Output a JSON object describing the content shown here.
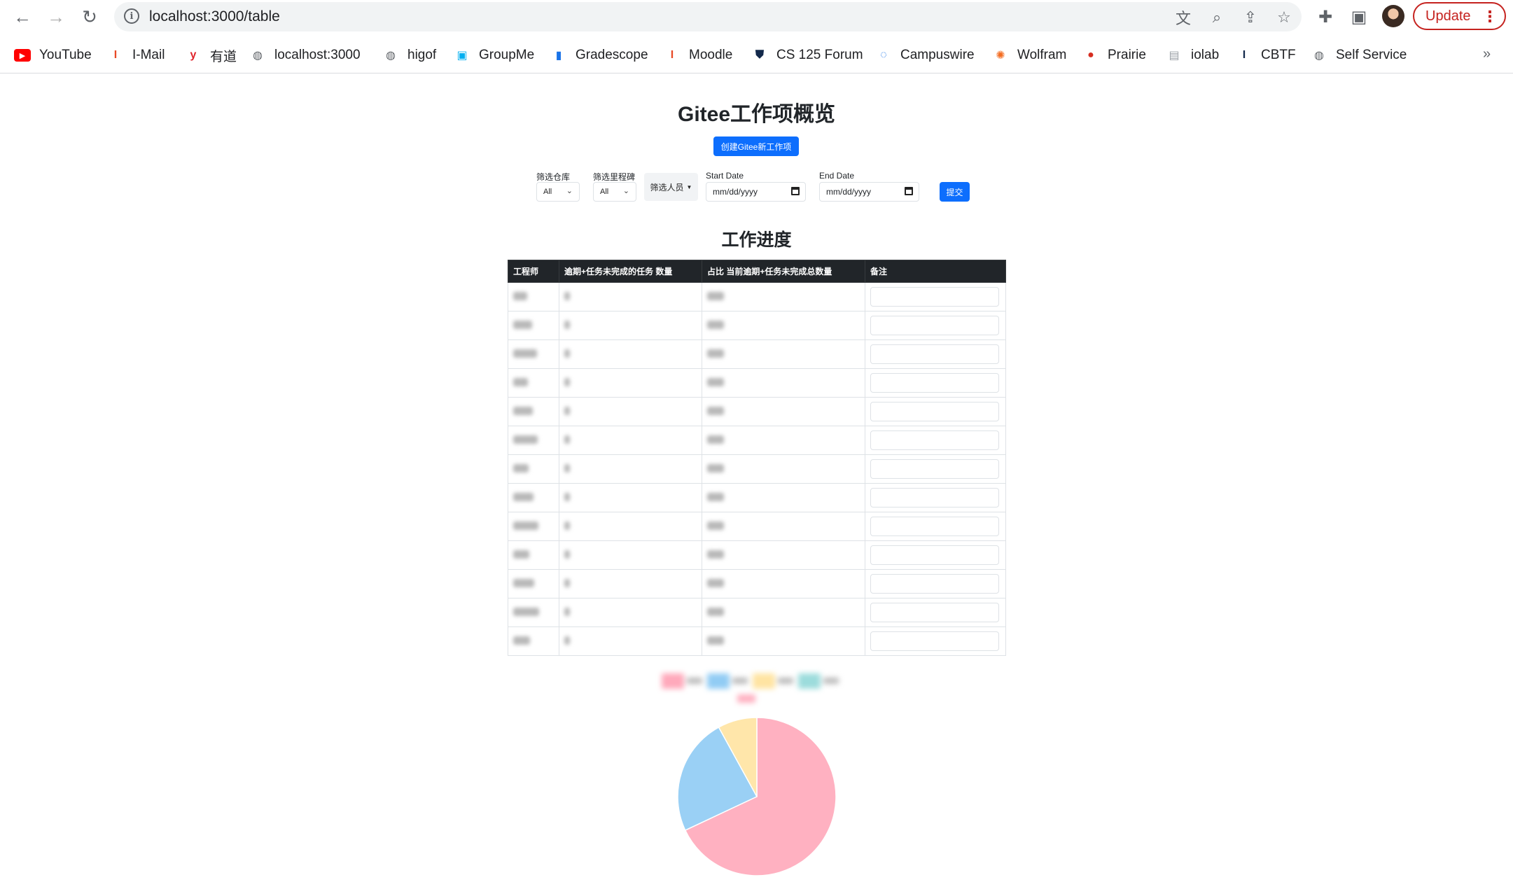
{
  "browser": {
    "url": "localhost:3000/table",
    "update_label": "Update",
    "bookmarks": [
      {
        "label": "YouTube",
        "icon": "youtube-icon",
        "color": "#ff0000"
      },
      {
        "label": "I-Mail",
        "icon": "illinois-icon",
        "color": "#e84a27"
      },
      {
        "label": "有道",
        "icon": "youdao-icon",
        "color": "#e0242b"
      },
      {
        "label": "localhost:3000",
        "icon": "globe-icon",
        "color": "#5f6368"
      },
      {
        "label": "higof",
        "icon": "globe-icon",
        "color": "#5f6368"
      },
      {
        "label": "GroupMe",
        "icon": "groupme-icon",
        "color": "#00aff0"
      },
      {
        "label": "Gradescope",
        "icon": "gradescope-icon",
        "color": "#1a73e8"
      },
      {
        "label": "Moodle",
        "icon": "illinois-icon",
        "color": "#e84a27"
      },
      {
        "label": "CS 125 Forum",
        "icon": "shield-icon",
        "color": "#13294b"
      },
      {
        "label": "Campuswire",
        "icon": "campuswire-icon",
        "color": "#1a73e8"
      },
      {
        "label": "Wolfram",
        "icon": "wolfram-icon",
        "color": "#f36c21"
      },
      {
        "label": "Prairie",
        "icon": "prairie-icon",
        "color": "#d62d20"
      },
      {
        "label": "iolab",
        "icon": "document-icon",
        "color": "#9aa0a6"
      },
      {
        "label": "CBTF",
        "icon": "illinois-icon",
        "color": "#13294b"
      },
      {
        "label": "Self Service",
        "icon": "globe-icon",
        "color": "#5f6368"
      }
    ]
  },
  "page": {
    "title": "Gitee工作项概览",
    "create_button": "创建Gitee新工作项",
    "filters": {
      "repo_label": "筛选仓库",
      "repo_value": "All",
      "milestone_label": "筛选里程碑",
      "milestone_value": "All",
      "person_label": "筛选人员",
      "start_label": "Start Date",
      "start_placeholder": "mm/dd/yyyy",
      "end_label": "End Date",
      "end_placeholder": "mm/dd/yyyy",
      "submit_label": "提交"
    },
    "section_title": "工作进度",
    "table": {
      "headers": [
        "工程师",
        "逾期+任务未完成的任务 数量",
        "占比 当前逾期+任务未完成总数量",
        "备注"
      ],
      "row_count": 13
    }
  },
  "chart_data": {
    "type": "pie",
    "slices": [
      {
        "value": 68,
        "color": "#ffb1c1"
      },
      {
        "value": 24,
        "color": "#9ad0f5"
      },
      {
        "value": 8,
        "color": "#ffe6aa"
      }
    ],
    "legend_colors": [
      "#ff6384",
      "#36a2eb",
      "#ffcd56",
      "#4bc0c0"
    ],
    "legend_placement": "top"
  }
}
